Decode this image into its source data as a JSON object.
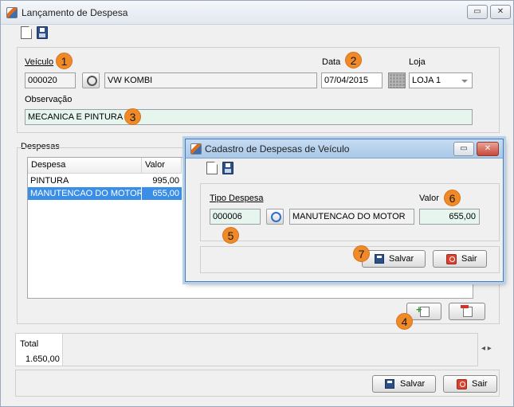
{
  "main": {
    "title": "Lançamento de Despesa",
    "labels": {
      "veiculo": "Veículo",
      "data": "Data",
      "loja": "Loja",
      "observacao": "Observação",
      "despesas": "Despesas",
      "total": "Total"
    },
    "veiculo_code": "000020",
    "veiculo_name": "VW KOMBI",
    "data_value": "07/04/2015",
    "loja_value": "LOJA 1",
    "observacao_value": "MECANICA E PINTURA",
    "table": {
      "columns": [
        "Despesa",
        "Valor"
      ],
      "rows": [
        {
          "despesa": "PINTURA",
          "valor": "995,00"
        },
        {
          "despesa": "MANUTENCAO DO MOTOR",
          "valor": "655,00"
        }
      ]
    },
    "total_value": "1.650,00",
    "scroll_arrows": "◂ ▸",
    "buttons": {
      "salvar": "Salvar",
      "sair": "Sair"
    }
  },
  "dialog": {
    "title": "Cadastro de Despesas de Veículo",
    "labels": {
      "tipo_despesa": "Tipo Despesa",
      "valor": "Valor"
    },
    "tipo_code": "000006",
    "tipo_name": "MANUTENCAO DO MOTOR",
    "valor_value": "655,00",
    "buttons": {
      "salvar": "Salvar",
      "sair": "Sair"
    }
  },
  "window_buttons": {
    "restore": "▭",
    "close": "✕"
  },
  "badges": [
    "1",
    "2",
    "3",
    "4",
    "5",
    "6",
    "7"
  ],
  "colors": {
    "badge": "#f08a28",
    "selection": "#3a8ee6",
    "green_field": "#e6f6ee"
  }
}
